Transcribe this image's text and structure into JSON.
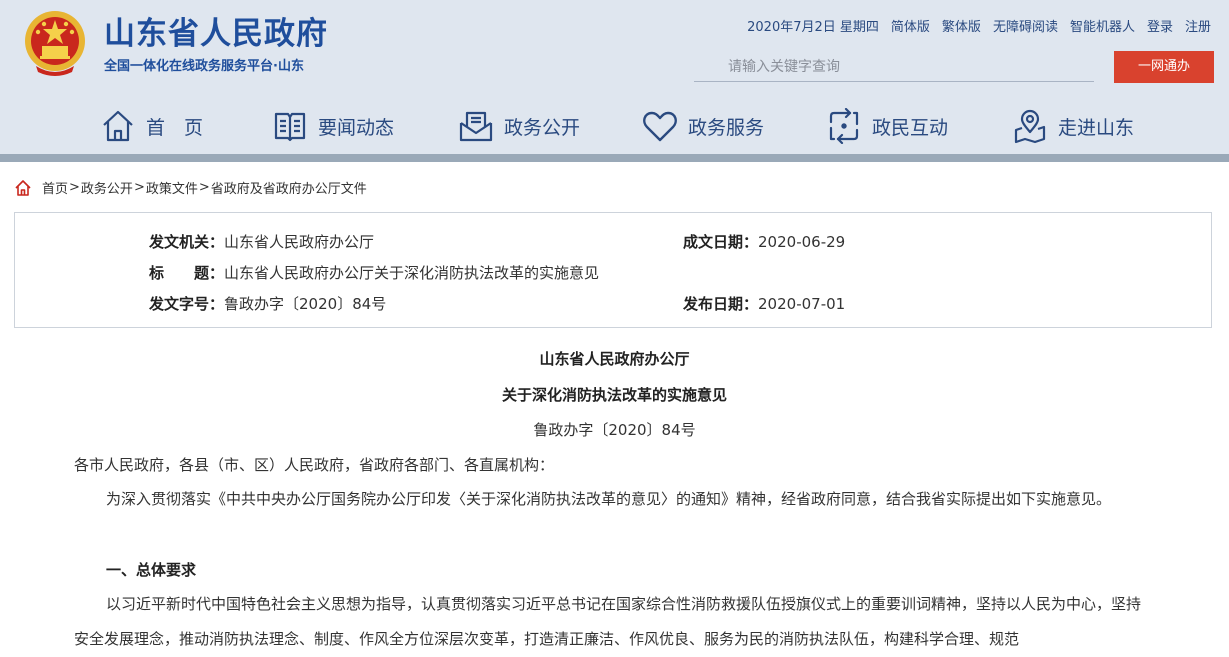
{
  "header": {
    "site_title": "山东省人民政府",
    "site_subtitle": "全国一体化在线政务服务平台·山东",
    "top_links": {
      "date": "2020年7月2日 星期四",
      "simplified": "简体版",
      "traditional": "繁体版",
      "accessible": "无障碍阅读",
      "robot": "智能机器人",
      "login": "登录",
      "register": "注册"
    },
    "search": {
      "placeholder": "请输入关键字查询",
      "button": "一网通办"
    },
    "nav": {
      "home": "首　页",
      "news": "要闻动态",
      "gov_open": "政务公开",
      "gov_service": "政务服务",
      "interaction": "政民互动",
      "about": "走进山东"
    }
  },
  "breadcrumb": {
    "items": [
      "首页",
      "政务公开",
      "政策文件",
      "省政府及省政府办公厅文件"
    ],
    "separator": ">"
  },
  "meta": {
    "issuer_label": "发文机关：",
    "issuer": "山东省人民政府办公厅",
    "date_written_label": "成文日期：",
    "date_written": "2020-06-29",
    "title_label": "标　　题：",
    "title": "山东省人民政府办公厅关于深化消防执法改革的实施意见",
    "doc_no_label": "发文字号：",
    "doc_no": "鲁政办字〔2020〕84号",
    "publish_date_label": "发布日期：",
    "publish_date": "2020-07-01"
  },
  "document": {
    "title_line1": "山东省人民政府办公厅",
    "title_line2": "关于深化消防执法改革的实施意见",
    "number": "鲁政办字〔2020〕84号",
    "salutation": "各市人民政府，各县（市、区）人民政府，省政府各部门、各直属机构：",
    "paragraph1": "为深入贯彻落实《中共中央办公厅国务院办公厅印发〈关于深化消防执法改革的意见〉的通知》精神，经省政府同意，结合我省实际提出如下实施意见。",
    "heading1": "一、总体要求",
    "paragraph2": "以习近平新时代中国特色社会主义思想为指导，认真贯彻落实习近平总书记在国家综合性消防救援队伍授旗仪式上的重要训词精神，坚持以人民为中心，坚持安全发展理念，推动消防执法理念、制度、作风全方位深层次变革，打造清正廉洁、作风优良、服务为民的消防执法队伍，构建科学合理、规范"
  },
  "colors": {
    "brand_blue": "#1f4e9c",
    "header_bg": "#dfe6ef",
    "accent_red": "#d9422e"
  }
}
